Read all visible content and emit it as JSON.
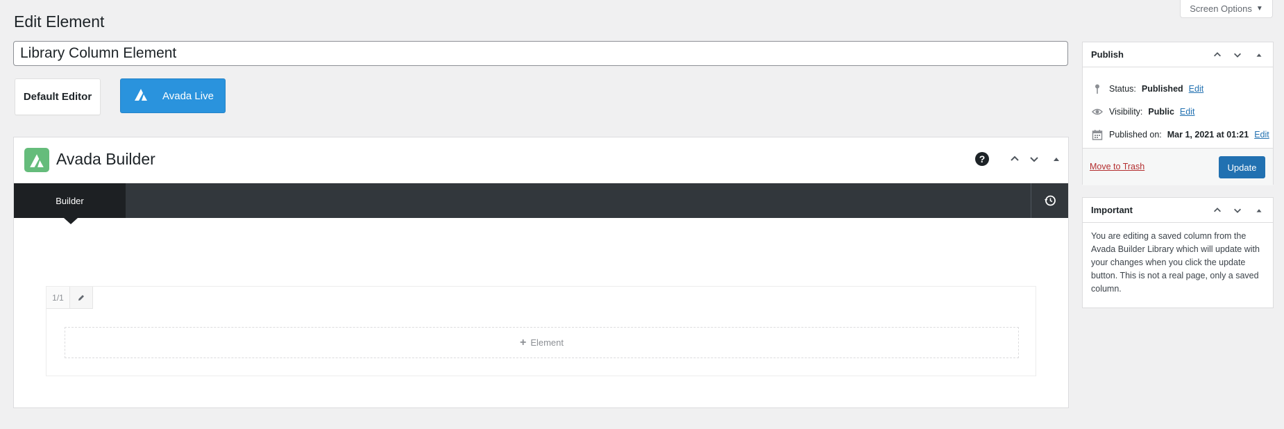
{
  "page": {
    "title": "Edit Element"
  },
  "screen_options": {
    "label": "Screen Options"
  },
  "post": {
    "title_value": "Library Column Element"
  },
  "editor_switch": {
    "default_editor_label": "Default Editor",
    "avada_live_label": "Avada Live"
  },
  "builder": {
    "title": "Avada Builder",
    "help_glyph": "?",
    "tab_label": "Builder",
    "column": {
      "size_label": "1/1",
      "add_element_label": "Element",
      "add_glyph": "+"
    }
  },
  "publish": {
    "title": "Publish",
    "status_label": "Status:",
    "status_value": "Published",
    "status_edit": "Edit",
    "visibility_label": "Visibility:",
    "visibility_value": "Public",
    "visibility_edit": "Edit",
    "published_on_label": "Published on:",
    "published_on_value": "Mar 1, 2021 at 01:21",
    "published_on_edit": "Edit",
    "trash_label": "Move to Trash",
    "update_label": "Update"
  },
  "important": {
    "title": "Important",
    "text": "You are editing a saved column from the Avada Builder Library which will update with your changes when you click the update button. This is not a real page, only a saved column."
  },
  "colors": {
    "avada_live": "#2a93dd",
    "avada_logo": "#65bc7b",
    "builder_bar": "#32373c",
    "update_button": "#2271b1",
    "trash_link": "#b32d2e"
  },
  "icons": [
    "avada-logo-icon",
    "help-icon",
    "chevron-up-icon",
    "chevron-down-icon",
    "caret-up-icon",
    "history-icon",
    "pencil-icon",
    "pin-icon",
    "eye-icon",
    "calendar-icon",
    "plus-icon"
  ]
}
